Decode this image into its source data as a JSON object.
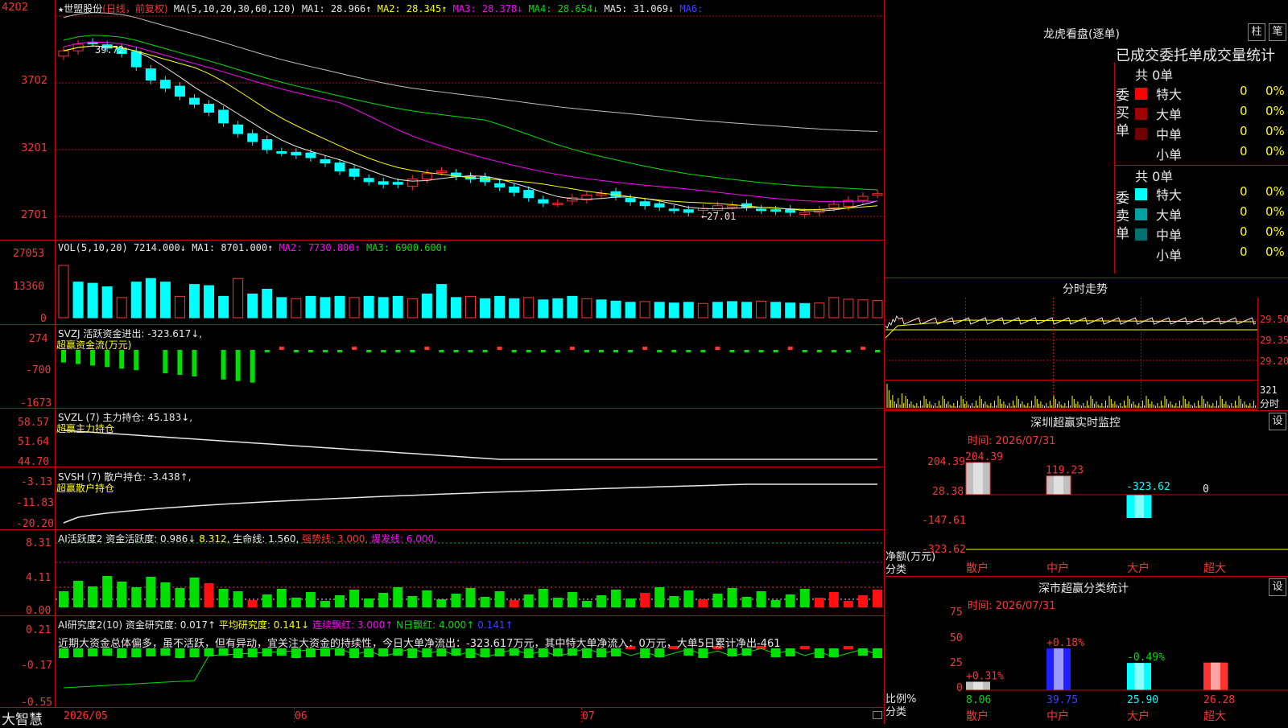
{
  "header": {
    "star": "★",
    "stock_name": "世盟股份",
    "period": "(日线，前复权)",
    "ma_label": "MA(5,10,20,30,60,120)",
    "ma": [
      {
        "label": "MA1:",
        "value": "28.966↑",
        "color": "#e8e8e8"
      },
      {
        "label": "MA2:",
        "value": "28.345↑",
        "color": "#ffff00"
      },
      {
        "label": "MA3:",
        "value": "28.378↓",
        "color": "#ff00ff"
      },
      {
        "label": "MA4:",
        "value": "28.654↓",
        "color": "#00e000"
      },
      {
        "label": "MA5:",
        "value": "31.069↓",
        "color": "#e8e8e8"
      },
      {
        "label": "MA6:",
        "value": "",
        "color": "#4040ff"
      }
    ]
  },
  "price_axis": [
    "4202",
    "3702",
    "3201",
    "2701"
  ],
  "price_annotations": {
    "high": "39.72",
    "low": "←27.01"
  },
  "vol_panel": {
    "title": "VOL(5,10,20)",
    "value": "7214.000↓",
    "ma": [
      {
        "label": "MA1:",
        "value": "8701.000↑",
        "color": "#e8e8e8"
      },
      {
        "label": "MA2:",
        "value": "7730.800↑",
        "color": "#ff00ff"
      },
      {
        "label": "MA3:",
        "value": "6900.600↑",
        "color": "#00e000"
      }
    ],
    "axis": [
      "27053",
      "13360",
      "0"
    ]
  },
  "svzj_panel": {
    "title": "SVZJ  活跃资金进出: -323.617↓,",
    "subtitle": "超赢资金流(万元)",
    "axis": [
      "274",
      "-700",
      "-1673"
    ]
  },
  "svzl_panel": {
    "title": "SVZL (7) 主力持仓: 45.183↓,",
    "subtitle": "超赢主力持仓",
    "axis": [
      "58.57",
      "51.64",
      "44.70"
    ]
  },
  "svsh_panel": {
    "title": "SVSH (7) 散户持仓: -3.438↑,",
    "subtitle": "超赢散户持仓",
    "axis": [
      "-3.13",
      "-11.83",
      "-20.20"
    ]
  },
  "ai_active_panel": {
    "title": "AI活跃度2 资金活跃度: 0.986↓",
    "items": [
      {
        "text": "8.312,",
        "color": "#ffff00"
      },
      {
        "text": "生命线: 1.560,",
        "color": "#e8e8e8"
      },
      {
        "text": "强势线: 3.000,",
        "color": "#ff3232"
      },
      {
        "text": "爆发线: 6.000,",
        "color": "#ff00ff"
      }
    ],
    "axis": [
      "8.31",
      "4.11",
      "0.00"
    ]
  },
  "ai_research_panel": {
    "title": "AI研究度2(10) 资金研究度: 0.017↑",
    "items": [
      {
        "text": "平均研究度: 0.141↓",
        "color": "#ffff00"
      },
      {
        "text": "连续飘红: 3.000↑",
        "color": "#ff00ff"
      },
      {
        "text": "N日飘红: 4.000↑",
        "color": "#00e000"
      },
      {
        "text": "0.141↑",
        "color": "#4040ff"
      }
    ],
    "comment": "近期大资金总体偏多，虽不活跃，但有异动，宜关注大资金的持续性，今日大单净流出：-323.617万元，其中特大单净流入：0万元，大单5日累计净出-461",
    "axis": [
      "0.21",
      "-0.17",
      "-0.55"
    ]
  },
  "date_axis": [
    "2026/05",
    "06",
    "07"
  ],
  "brand": "大智慧",
  "right": {
    "dragon_title": "龙虎看盘(逐单)",
    "btn_column": "柱",
    "btn_brush": "笔",
    "table_header": "已成交委托单成交量统计",
    "buy_label": "委买单",
    "sell_label": "委卖单",
    "buy_total": "共 0单",
    "sell_total": "共 0单",
    "buy_rows": [
      {
        "name": "特大",
        "count": "0",
        "pct": "0%",
        "color": "#ff0000"
      },
      {
        "name": "大单",
        "count": "0",
        "pct": "0%",
        "color": "#a00000"
      },
      {
        "name": "中单",
        "count": "0",
        "pct": "0%",
        "color": "#700000"
      },
      {
        "name": "小单",
        "count": "0",
        "pct": "0%",
        "color": "#000000"
      }
    ],
    "sell_rows": [
      {
        "name": "特大",
        "count": "0",
        "pct": "0%",
        "color": "#00ffff"
      },
      {
        "name": "大单",
        "count": "0",
        "pct": "0%",
        "color": "#00a0a0"
      },
      {
        "name": "中单",
        "count": "0",
        "pct": "0%",
        "color": "#007070"
      },
      {
        "name": "小单",
        "count": "0",
        "pct": "0%",
        "color": "#000000"
      }
    ],
    "intraday_title": "分时走势",
    "intraday_axis": [
      "29.50",
      "29.35",
      "29.20",
      "321",
      "分时"
    ],
    "monitor_title": "深圳超赢实时监控",
    "monitor_btn": "设",
    "monitor_time": "时间: 2026/07/31",
    "monitor_axis": [
      "204.39",
      "28.38",
      "-147.61",
      "-323.62"
    ],
    "monitor_ylabel": "净额(万元)",
    "monitor_xlabel": "分类",
    "monitor_bars": [
      {
        "cat": "散户",
        "value": 204.39,
        "label": "204.39",
        "label_color": "#ff3232"
      },
      {
        "cat": "中户",
        "value": 119.23,
        "label": "119.23",
        "label_color": "#ff3232"
      },
      {
        "cat": "大户",
        "value": -323.62,
        "label": "-323.62",
        "label_color": "#00ffff"
      },
      {
        "cat": "超大",
        "value": 0,
        "label": "0",
        "label_color": "#e8e8e8"
      }
    ],
    "stats_title": "深市超赢分类统计",
    "stats_btn": "设",
    "stats_time": "时间: 2026/07/31",
    "stats_axis": [
      "75",
      "50",
      "25",
      "0"
    ],
    "stats_ylabel": "比例%",
    "stats_xlabel": "分类",
    "stats_bars": [
      {
        "cat": "散户",
        "value": 8.06,
        "label": "8.06",
        "change": "+0.31%",
        "change_color": "#ff3232",
        "color": "#c0c0c0",
        "label_color": "#00e000"
      },
      {
        "cat": "中户",
        "value": 39.75,
        "label": "39.75",
        "change": "+0.18%",
        "change_color": "#ff3232",
        "color": "#2020ff",
        "label_color": "#4040ff"
      },
      {
        "cat": "大户",
        "value": 25.9,
        "label": "25.90",
        "change": "-0.49%",
        "change_color": "#00e000",
        "color": "#00ffff",
        "label_color": "#00ffff"
      },
      {
        "cat": "超大",
        "value": 26.28,
        "label": "26.28",
        "change": "",
        "change_color": "#ff3232",
        "color": "#ff3232",
        "label_color": "#ff3232"
      }
    ]
  }
}
